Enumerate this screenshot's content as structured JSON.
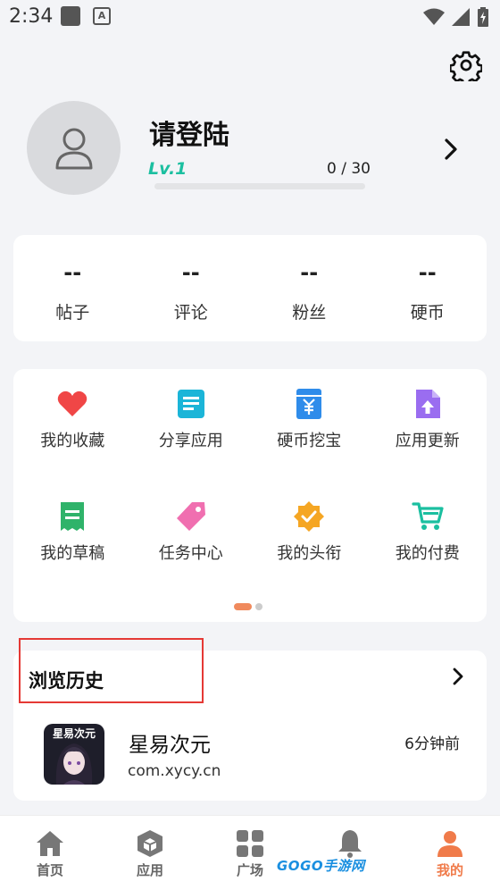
{
  "status_bar": {
    "time": "2:34"
  },
  "profile": {
    "username": "请登陆",
    "level": "Lv.1",
    "xp": "0 / 30",
    "xp_progress": 0
  },
  "stats": [
    {
      "value": "--",
      "label": "帖子"
    },
    {
      "value": "--",
      "label": "评论"
    },
    {
      "value": "--",
      "label": "粉丝"
    },
    {
      "value": "--",
      "label": "硬币"
    }
  ],
  "menu": {
    "items": [
      {
        "label": "我的收藏",
        "icon": "heart-icon",
        "color": "#f04646"
      },
      {
        "label": "分享应用",
        "icon": "document-icon",
        "color": "#1bb5d8"
      },
      {
        "label": "硬币挖宝",
        "icon": "coin-pouch-icon",
        "color": "#2f8cea"
      },
      {
        "label": "应用更新",
        "icon": "upload-file-icon",
        "color": "#9a6df0"
      },
      {
        "label": "我的草稿",
        "icon": "draft-icon",
        "color": "#2fb36a"
      },
      {
        "label": "任务中心",
        "icon": "tag-icon",
        "color": "#f06fb0"
      },
      {
        "label": "我的头衔",
        "icon": "badge-icon",
        "color": "#f5a623"
      },
      {
        "label": "我的付费",
        "icon": "cart-icon",
        "color": "#1bbfa0"
      }
    ]
  },
  "history": {
    "title": "浏览历史",
    "items": [
      {
        "name": "星易次元",
        "package": "com.xycy.cn",
        "time": "6分钟前",
        "icon_text": "星易次元"
      }
    ]
  },
  "nav": {
    "items": [
      {
        "label": "首页",
        "icon": "home-icon"
      },
      {
        "label": "应用",
        "icon": "apps-cube-icon"
      },
      {
        "label": "广场",
        "icon": "grid-icon"
      },
      {
        "label": "",
        "icon": "bell-icon"
      },
      {
        "label": "我的",
        "icon": "person-icon"
      }
    ],
    "active": "我的",
    "active_color": "#f07b4a"
  },
  "watermark": "GOGO手游网"
}
